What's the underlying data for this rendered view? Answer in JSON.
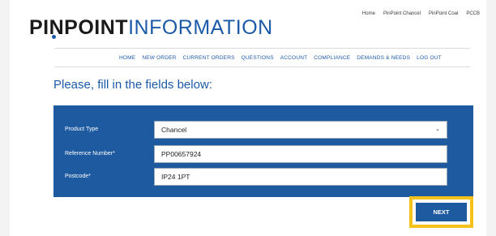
{
  "brand": {
    "logo_part1": "PINPOINT",
    "logo_part2": "INFORMATION"
  },
  "top_links": [
    "Home",
    "PinPoint Chancel",
    "PinPoint Coal",
    "PCCB"
  ],
  "main_nav": [
    "HOME",
    "NEW ORDER",
    "CURRENT ORDERS",
    "QUESTIONS",
    "ACCOUNT",
    "COMPLIANCE",
    "DEMANDS & NEEDS",
    "LOG OUT"
  ],
  "form": {
    "heading": "Please, fill in the fields below:",
    "fields": [
      {
        "label": "Product Type",
        "value": "Chancel"
      },
      {
        "label": "Reference Number*",
        "value": "PP00657924"
      },
      {
        "label": "Postcode*",
        "value": "IP24 1PT"
      }
    ]
  },
  "next_button": {
    "label": "NEXT"
  },
  "colors": {
    "brand_blue": "#1e5aa0",
    "highlight": "#f4c21a",
    "logo_dark": "#1a1a1a"
  }
}
